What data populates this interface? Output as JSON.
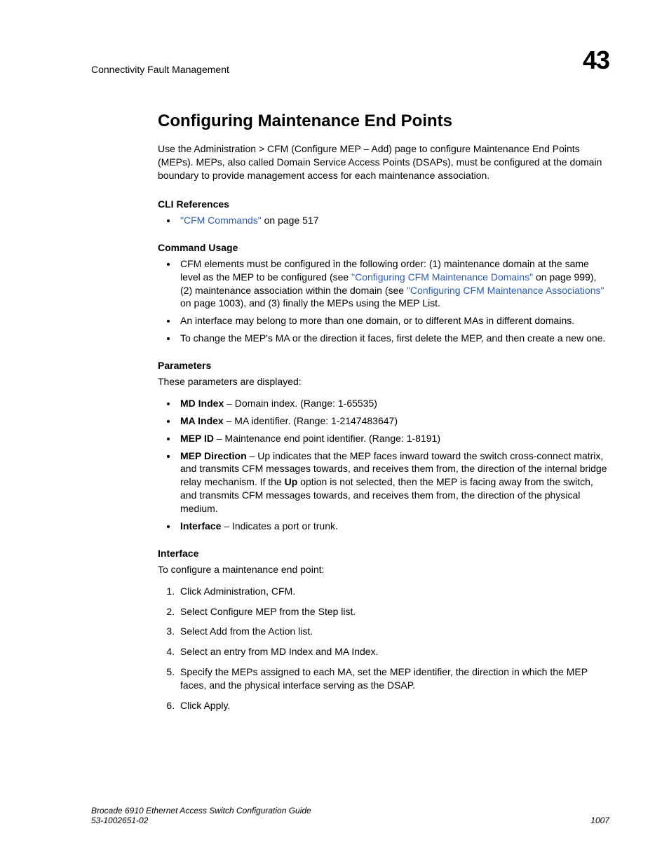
{
  "header": {
    "running": "Connectivity Fault Management",
    "chapter": "43"
  },
  "title": "Configuring Maintenance End Points",
  "intro": "Use the Administration > CFM (Configure MEP – Add) page to configure Maintenance End Points (MEPs). MEPs, also called Domain Service Access Points (DSAPs), must be configured at the domain boundary to provide management access for each maintenance association.",
  "cliref": {
    "heading": "CLI References",
    "link": "\"CFM Commands\"",
    "after": " on page 517"
  },
  "usage": {
    "heading": "Command Usage",
    "item1": {
      "pre": "CFM elements must be configured in the following order: (1) maintenance domain at the same level as the MEP to be configured (see ",
      "link1": "\"Configuring CFM Maintenance Domains\"",
      "mid1": " on page 999), (2) maintenance association within the domain (see ",
      "link2": "\"Configuring CFM Maintenance Associations\"",
      "post": " on page 1003), and (3) finally the MEPs using the MEP List."
    },
    "item2": "An interface may belong to more than one domain, or to different MAs in different domains.",
    "item3": "To change the MEP's MA or the direction it faces, first delete the MEP, and then create a new one."
  },
  "params": {
    "heading": "Parameters",
    "sub": "These parameters are displayed:",
    "p1": {
      "name": "MD Index",
      "desc": " – Domain index. (Range: 1-65535)"
    },
    "p2": {
      "name": "MA Index",
      "desc": " – MA identifier. (Range: 1-2147483647)"
    },
    "p3": {
      "name": "MEP ID",
      "desc": " – Maintenance end point identifier. (Range: 1-8191)"
    },
    "p4": {
      "name": "MEP Direction",
      "desc1": " – Up indicates that the MEP faces inward toward the switch cross-connect matrix, and transmits CFM messages towards, and receives them from, the direction of the internal bridge relay mechanism. If the ",
      "up": "Up",
      "desc2": " option is not selected, then the MEP is facing away from the switch, and transmits CFM messages towards, and receives them from, the direction of the physical medium."
    },
    "p5": {
      "name": "Interface",
      "desc": " – Indicates a port or trunk."
    }
  },
  "iface": {
    "heading": "Interface",
    "sub": "To configure a maintenance end point:",
    "s1": "Click Administration, CFM.",
    "s2": "Select Configure MEP from the Step list.",
    "s3": "Select Add from the Action list.",
    "s4": "Select an entry from MD Index and MA Index.",
    "s5": "Specify the MEPs assigned to each MA, set the MEP identifier, the direction in which the MEP faces, and the physical interface serving as the DSAP.",
    "s6": "Click Apply."
  },
  "footer": {
    "line1": "Brocade 6910 Ethernet Access Switch Configuration Guide",
    "line2": "53-1002651-02",
    "page": "1007"
  }
}
